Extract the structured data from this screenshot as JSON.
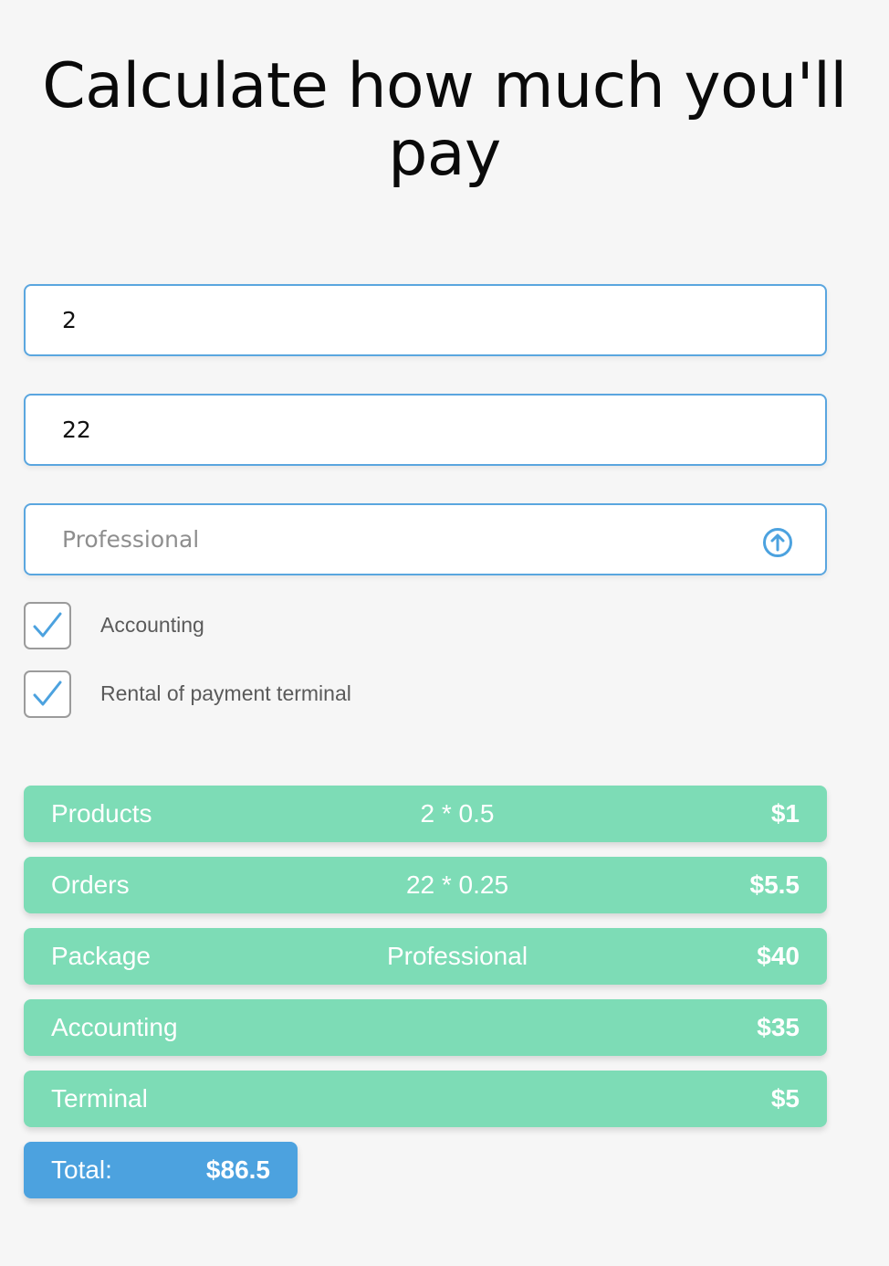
{
  "page": {
    "title": "Calculate how much you'll pay"
  },
  "form": {
    "products_value": "2",
    "orders_value": "22",
    "package_value": "Professional",
    "package_icon": "arrow-up-circle-icon",
    "options": [
      {
        "label": "Accounting",
        "checked": true
      },
      {
        "label": "Rental of payment terminal",
        "checked": true
      }
    ]
  },
  "breakdown": [
    {
      "label": "Products",
      "detail": "2 * 0.5",
      "price": "$1"
    },
    {
      "label": "Orders",
      "detail": "22 * 0.25",
      "price": "$5.5"
    },
    {
      "label": "Package",
      "detail": "Professional",
      "price": "$40"
    },
    {
      "label": "Accounting",
      "detail": "",
      "price": "$35"
    },
    {
      "label": "Terminal",
      "detail": "",
      "price": "$5"
    }
  ],
  "total": {
    "label": "Total:",
    "value": "$86.5"
  },
  "colors": {
    "accent_blue": "#4ca2df",
    "row_green": "#7ddcb6",
    "background": "#f6f6f6"
  }
}
